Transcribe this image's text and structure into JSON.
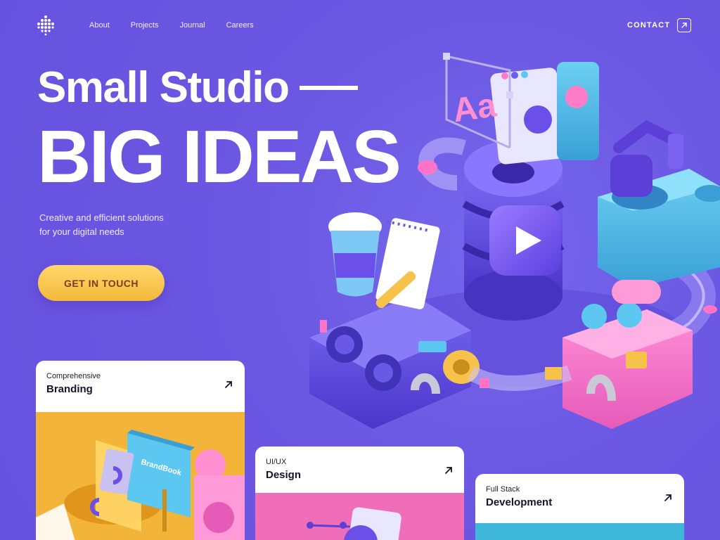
{
  "nav": {
    "items": [
      {
        "label": "About"
      },
      {
        "label": "Projects"
      },
      {
        "label": "Journal"
      },
      {
        "label": "Careers"
      }
    ],
    "contact_label": "CONTACT"
  },
  "hero": {
    "line1": "Small Studio",
    "line2": "BIG IDEAS",
    "subtitle_line1": "Creative and efficient solutions",
    "subtitle_line2": "for your digital needs",
    "cta_label": "GET IN TOUCH"
  },
  "cards": [
    {
      "kicker": "Comprehensive",
      "title": "Branding",
      "image_text": "BrandBook"
    },
    {
      "kicker": "UI/UX",
      "title": "Design"
    },
    {
      "kicker": "Full Stack",
      "title": "Development"
    }
  ],
  "colors": {
    "background": "#6e5ce6",
    "cta": "#f4b93b",
    "cta_text": "#7a3c1a",
    "card_branding_bg": "#f2b53a",
    "card_design_bg": "#f06db8",
    "card_dev_bg": "#3fb7d9"
  },
  "icons": [
    "logo-dots-icon",
    "arrow-up-right-icon",
    "play-icon"
  ]
}
